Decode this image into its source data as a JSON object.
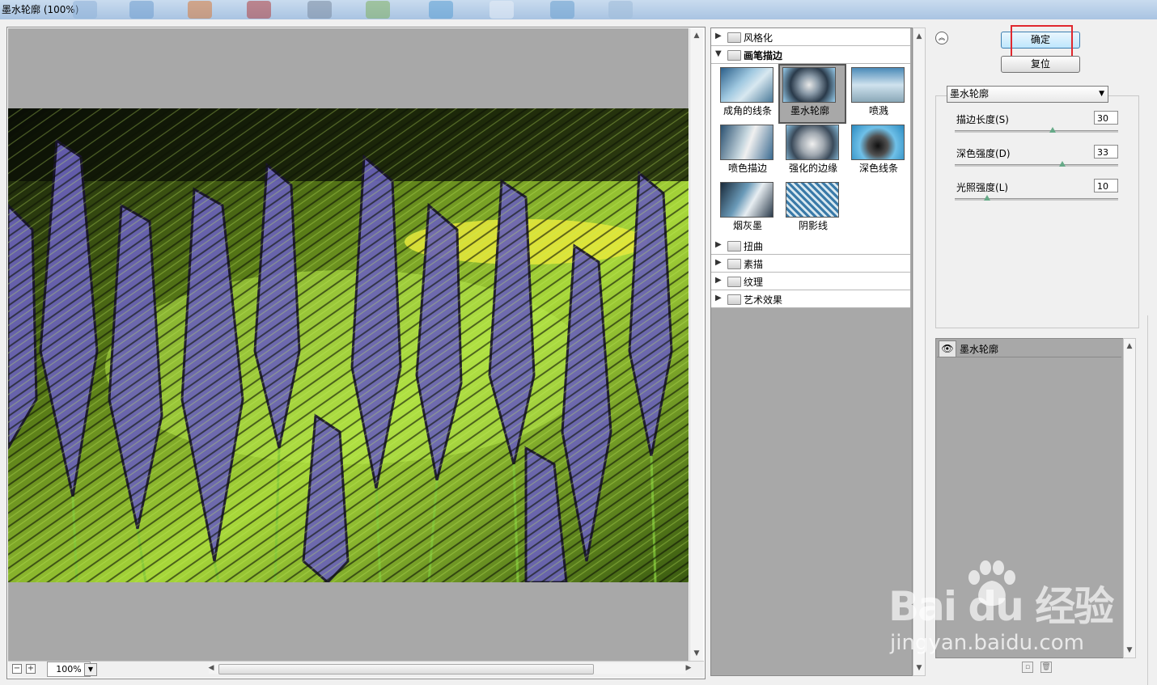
{
  "window": {
    "title": "墨水轮廓 (100%)"
  },
  "preview": {
    "zoom": "100%",
    "zoom_out": "−",
    "zoom_in": "+"
  },
  "gallery": {
    "categories_top": [
      {
        "name": "风格化",
        "expanded": false
      },
      {
        "name": "画笔描边",
        "expanded": true
      }
    ],
    "thumbnails": [
      {
        "label": "成角的线条"
      },
      {
        "label": "墨水轮廓",
        "selected": true
      },
      {
        "label": "喷溅"
      },
      {
        "label": "喷色描边"
      },
      {
        "label": "强化的边缘"
      },
      {
        "label": "深色线条"
      },
      {
        "label": "烟灰墨"
      },
      {
        "label": "阴影线"
      }
    ],
    "categories_bottom": [
      {
        "name": "扭曲"
      },
      {
        "name": "素描"
      },
      {
        "name": "纹理"
      },
      {
        "name": "艺术效果"
      }
    ]
  },
  "buttons": {
    "ok": "确定",
    "reset": "复位"
  },
  "filter": {
    "selected": "墨水轮廓"
  },
  "params": [
    {
      "label": "描边长度(S)",
      "value": "30",
      "level": 0.6
    },
    {
      "label": "深色强度(D)",
      "value": "33",
      "level": 0.66
    },
    {
      "label": "光照强度(L)",
      "value": "10",
      "level": 0.2
    }
  ],
  "layers": [
    {
      "name": "墨水轮廓",
      "visible": true
    }
  ],
  "watermark": {
    "brand": "Bai du 经验",
    "url": "jingyan.baidu.com"
  },
  "colors": {
    "canvas": "#a8a8a8",
    "highlight": "#e0282e",
    "accent": "#3c7fb1"
  }
}
